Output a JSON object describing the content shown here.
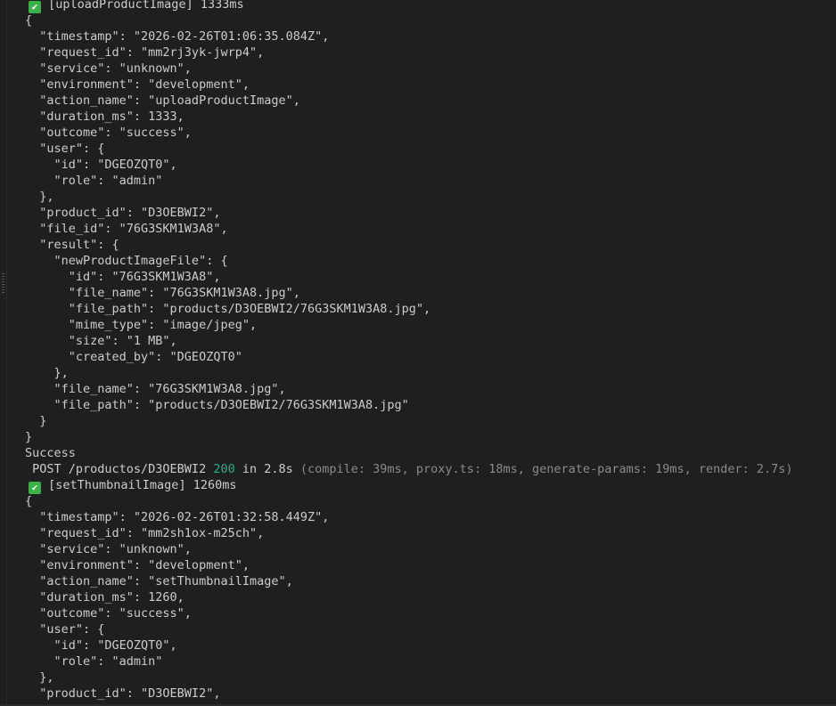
{
  "terminal": {
    "colors": {
      "background": "#1f1f1f",
      "text": "#cccccc",
      "check": "#3bb14a",
      "status_ok": "#1fb28e",
      "dim": "#8a8a8a"
    },
    "block1": {
      "header": "[uploadProductImage] 1333ms",
      "lines": [
        "{",
        "  \"timestamp\": \"2026-02-26T01:06:35.084Z\",",
        "  \"request_id\": \"mm2rj3yk-jwrp4\",",
        "  \"service\": \"unknown\",",
        "  \"environment\": \"development\",",
        "  \"action_name\": \"uploadProductImage\",",
        "  \"duration_ms\": 1333,",
        "  \"outcome\": \"success\",",
        "  \"user\": {",
        "    \"id\": \"DGEOZQT0\",",
        "    \"role\": \"admin\"",
        "  },",
        "  \"product_id\": \"D3OEBWI2\",",
        "  \"file_id\": \"76G3SKM1W3A8\",",
        "  \"result\": {",
        "    \"newProductImageFile\": {",
        "      \"id\": \"76G3SKM1W3A8\",",
        "      \"file_name\": \"76G3SKM1W3A8.jpg\",",
        "      \"file_path\": \"products/D3OEBWI2/76G3SKM1W3A8.jpg\",",
        "      \"mime_type\": \"image/jpeg\",",
        "      \"size\": \"1 MB\",",
        "      \"created_by\": \"DGEOZQT0\"",
        "    },",
        "    \"file_name\": \"76G3SKM1W3A8.jpg\",",
        "    \"file_path\": \"products/D3OEBWI2/76G3SKM1W3A8.jpg\"",
        "  }",
        "}"
      ]
    },
    "success_text": "Success",
    "request_log": {
      "method_path": " POST /productos/D3OEBWI2 ",
      "status": "200",
      "timing": " in 2.8s ",
      "details": "(compile: 39ms, proxy.ts: 18ms, generate-params: 19ms, render: 2.7s)"
    },
    "block2": {
      "header": "[setThumbnailImage] 1260ms",
      "lines": [
        "{",
        "  \"timestamp\": \"2026-02-26T01:32:58.449Z\",",
        "  \"request_id\": \"mm2sh1ox-m25ch\",",
        "  \"service\": \"unknown\",",
        "  \"environment\": \"development\",",
        "  \"action_name\": \"setThumbnailImage\",",
        "  \"duration_ms\": 1260,",
        "  \"outcome\": \"success\",",
        "  \"user\": {",
        "    \"id\": \"DGEOZQT0\",",
        "    \"role\": \"admin\"",
        "  },",
        "  \"product_id\": \"D3OEBWI2\","
      ]
    }
  }
}
